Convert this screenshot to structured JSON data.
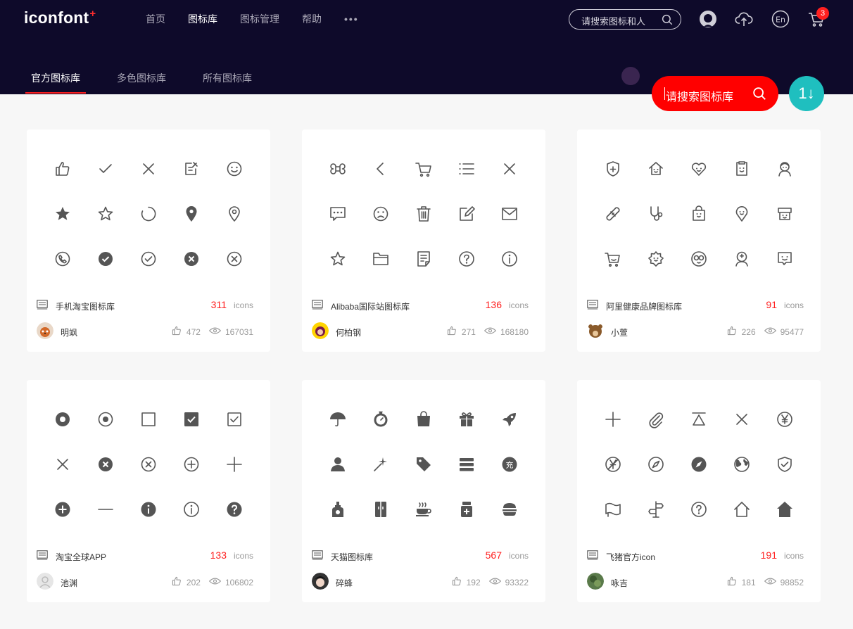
{
  "header": {
    "logo_text": "iconfont",
    "logo_plus": "+",
    "nav": [
      "首页",
      "图标库",
      "图标管理",
      "帮助"
    ],
    "nav_more": "•••",
    "search_placeholder": "请搜索图标和人",
    "cart_count": "3",
    "icons": [
      "search-icon",
      "github-icon",
      "upload-cloud-icon",
      "language-en-icon",
      "cart-icon"
    ]
  },
  "tabs": [
    "官方图标库",
    "多色图标库",
    "所有图标库"
  ],
  "main_search": {
    "placeholder": "请搜索图标库",
    "sort_label": "1↓"
  },
  "colors": {
    "header_bg": "#0e0a2a",
    "accent_red": "#ff0000",
    "teal": "#1fbfbf",
    "icon_gray": "#555555"
  },
  "cards": [
    {
      "name": "手机淘宝图标库",
      "count": "311",
      "unit": "icons",
      "author": "明飒",
      "likes": "472",
      "views": "167031",
      "icons": [
        "thumbs-up-icon",
        "check-icon",
        "close-icon",
        "edit-note-icon",
        "smile-icon",
        "star-filled-icon",
        "star-outline-icon",
        "loading-circle-icon",
        "location-filled-icon",
        "location-outline-icon",
        "phone-circle-icon",
        "check-circle-filled-icon",
        "check-circle-outline-icon",
        "close-circle-filled-icon",
        "close-circle-outline-icon"
      ]
    },
    {
      "name": "Alibaba国际站图标库",
      "count": "136",
      "unit": "icons",
      "author": "何柏钢",
      "likes": "271",
      "views": "168180",
      "icons": [
        "command-icon",
        "chevron-left-icon",
        "cart-icon",
        "list-icon",
        "close-icon",
        "message-icon",
        "sad-face-icon",
        "trash-icon",
        "edit-box-icon",
        "mail-icon",
        "star-outline-icon",
        "folder-icon",
        "document-icon",
        "help-circle-icon",
        "info-circle-icon"
      ]
    },
    {
      "name": "阿里健康品牌图标库",
      "count": "91",
      "unit": "icons",
      "author": "小萱",
      "likes": "226",
      "views": "95477",
      "icons": [
        "shield-plus-icon",
        "house-face-icon",
        "heart-face-icon",
        "clipboard-face-icon",
        "nurse-icon",
        "bandage-icon",
        "stethoscope-icon",
        "bag-face-icon",
        "pin-face-icon",
        "store-face-icon",
        "cart-face-icon",
        "gear-face-icon",
        "owl-face-icon",
        "doctor-icon",
        "chat-face-icon"
      ]
    },
    {
      "name": "淘宝全球APP",
      "count": "133",
      "unit": "icons",
      "author": "池渊",
      "likes": "202",
      "views": "106802",
      "icons": [
        "radio-filled-icon",
        "radio-outline-icon",
        "checkbox-empty-icon",
        "checkbox-filled-icon",
        "checkbox-outline-icon",
        "close-icon",
        "close-circle-filled-icon",
        "close-circle-outline-icon",
        "plus-circle-outline-icon",
        "plus-icon",
        "plus-circle-filled-icon",
        "minus-icon",
        "info-filled-icon",
        "info-outline-icon",
        "help-filled-icon"
      ]
    },
    {
      "name": "天猫图标库",
      "count": "567",
      "unit": "icons",
      "author": "碎蜂",
      "likes": "192",
      "views": "93322",
      "icons": [
        "umbrella-icon",
        "timer-icon",
        "shopping-bag-icon",
        "gift-icon",
        "rocket-icon",
        "user-icon",
        "magic-wand-icon",
        "tag-icon",
        "menu-icon",
        "recharge-icon",
        "perfume-icon",
        "fridge-icon",
        "coffee-icon",
        "medicine-icon",
        "burger-icon"
      ]
    },
    {
      "name": "飞猪官方icon",
      "count": "191",
      "unit": "icons",
      "author": "咏吉",
      "likes": "181",
      "views": "98852",
      "icons": [
        "plus-icon",
        "paperclip-icon",
        "triangle-icon",
        "close-icon",
        "yen-circle-icon",
        "yen-off-circle-icon",
        "compass-outline-icon",
        "compass-filled-icon",
        "globe-icon",
        "shield-check-icon",
        "flag-map-icon",
        "signpost-icon",
        "help-circle-icon",
        "home-outline-icon",
        "home-filled-icon"
      ]
    }
  ]
}
